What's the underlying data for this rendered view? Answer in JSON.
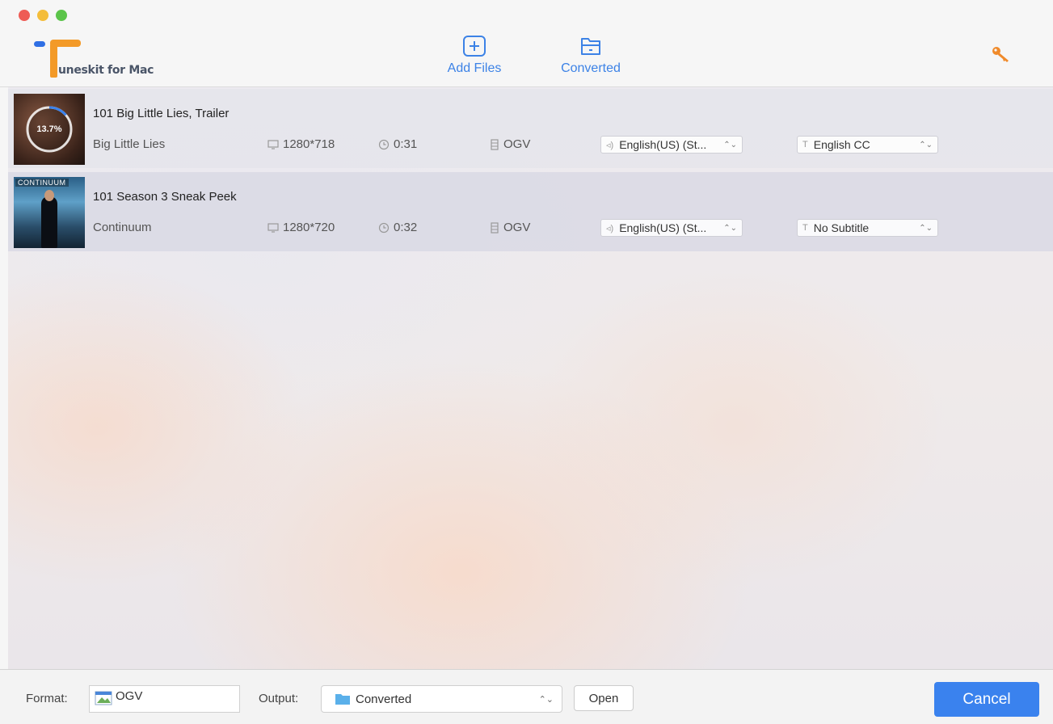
{
  "app": {
    "logo_text": "uneskit for Mac"
  },
  "toolbar": {
    "add_files_label": "Add Files",
    "converted_label": "Converted",
    "add_files_icon": "add-file-icon",
    "converted_icon": "folder-icon",
    "register_icon": "key-icon"
  },
  "files": [
    {
      "title": "101 Big Little Lies, Trailer",
      "show": "Big Little Lies",
      "resolution": "1280*718",
      "duration": "0:31",
      "format": "OGV",
      "audio": "English(US) (St...",
      "subtitle": "English CC",
      "progress_text": "13.7%",
      "progress": 0.137
    },
    {
      "title": "101 Season 3 Sneak Peek",
      "show": "Continuum",
      "resolution": "1280*720",
      "duration": "0:32",
      "format": "OGV",
      "audio": "English(US) (St...",
      "subtitle": "No Subtitle",
      "thumb_title": "CONTINUUM"
    }
  ],
  "bottom": {
    "format_label": "Format:",
    "format_value": "OGV",
    "output_label": "Output:",
    "output_value": "Converted",
    "open_label": "Open",
    "cancel_label": "Cancel"
  },
  "colors": {
    "accent": "#3a82ee",
    "logo_orange": "#f39a28",
    "logo_blue": "#2f6fe4",
    "key_orange": "#f08a2a"
  }
}
